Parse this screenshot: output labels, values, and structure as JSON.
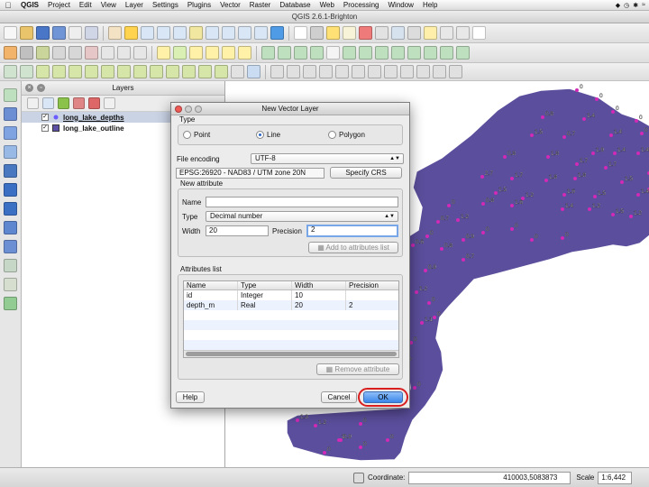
{
  "menubar": {
    "apple_icon": "apple-logo-icon",
    "items": [
      "QGIS",
      "Project",
      "Edit",
      "View",
      "Layer",
      "Settings",
      "Plugins",
      "Vector",
      "Raster",
      "Database",
      "Web",
      "Processing",
      "Window",
      "Help"
    ]
  },
  "window": {
    "title": "QGIS 2.6.1-Brighton"
  },
  "layers_panel": {
    "title": "Layers",
    "layers": [
      {
        "name": "long_lake_depths",
        "checked": true,
        "selected": true,
        "symbol_color": "#6a5cff"
      },
      {
        "name": "long_lake_outline",
        "checked": true,
        "selected": false,
        "symbol_color": "#5b4fa6"
      }
    ]
  },
  "map": {
    "polygon_color": "#5b4e9c",
    "point_color": "#d12ab6",
    "depth_labels": [
      "0",
      "0",
      "0",
      "0",
      "0.8",
      "1.4",
      "1.4",
      "0",
      "1.5",
      "0.7",
      "1.9",
      "1.4",
      "1.4",
      "0.8",
      "1.8",
      "1.7",
      "1.7",
      "0.9",
      "2.7",
      "1.7",
      "1.8",
      "1.8",
      "1.5",
      "1.9",
      "1.5",
      "1.2",
      "1.6",
      "1.5",
      "1.4",
      "0",
      "0.8",
      "1.6",
      "1.4",
      "1.2",
      "1.5",
      "1.2",
      "0",
      "0.7",
      "1.2",
      "0.9",
      "0",
      "0",
      "0",
      "0",
      "0.6",
      "0.8",
      "0.7",
      "0.9",
      "1.2",
      "0",
      "0",
      "1.1",
      "0",
      "0",
      "0",
      "0",
      "1.3",
      "1.2",
      "1",
      "0",
      "0.9",
      "0",
      "0",
      "0"
    ]
  },
  "dialog": {
    "title": "New Vector Layer",
    "type_label": "Type",
    "type_options": [
      {
        "label": "Point",
        "checked": false
      },
      {
        "label": "Line",
        "checked": true
      },
      {
        "label": "Polygon",
        "checked": false
      }
    ],
    "encoding_label": "File encoding",
    "encoding_value": "UTF-8",
    "crs_value": "EPSG:26920 - NAD83 / UTM zone 20N",
    "specify_crs_label": "Specify CRS",
    "new_attribute": {
      "title": "New attribute",
      "name_label": "Name",
      "name_value": "",
      "type_label": "Type",
      "type_value": "Decimal number",
      "width_label": "Width",
      "width_value": "20",
      "precision_label": "Precision",
      "precision_value": "2",
      "add_button": "Add to attributes list"
    },
    "attributes_list": {
      "title": "Attributes list",
      "columns": [
        "Name",
        "Type",
        "Width",
        "Precision"
      ],
      "rows": [
        [
          "id",
          "Integer",
          "10",
          ""
        ],
        [
          "depth_m",
          "Real",
          "20",
          "2"
        ]
      ],
      "remove_button": "Remove attribute"
    },
    "help_button": "Help",
    "cancel_button": "Cancel",
    "ok_button": "OK",
    "highlight_color": "#d81e1e"
  },
  "statusbar": {
    "coordinate_label": "Coordinate:",
    "coordinate_value": "410003,5083873",
    "scale_label": "Scale",
    "scale_value": "1:6,442"
  }
}
